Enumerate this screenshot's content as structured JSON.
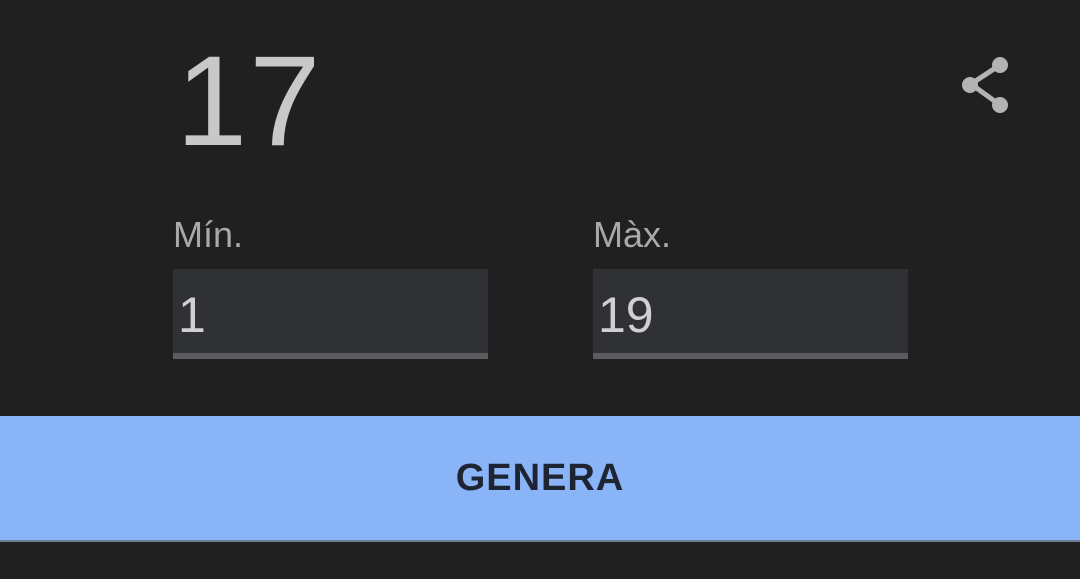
{
  "result": {
    "value": "17"
  },
  "share": {
    "icon": "share-icon",
    "color": "#b3b3b3"
  },
  "min": {
    "label": "Mín.",
    "value": "1"
  },
  "max": {
    "label": "Màx.",
    "value": "19"
  },
  "generate": {
    "label": "GENERA",
    "background": "#8ab4f8"
  }
}
